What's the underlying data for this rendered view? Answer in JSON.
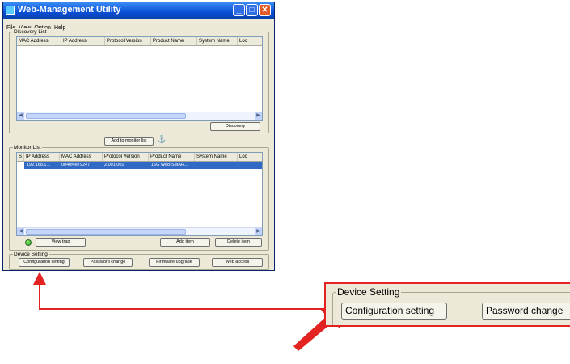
{
  "window": {
    "title": "Web-Management Utility"
  },
  "menu": [
    "File",
    "View",
    "Option",
    "Help"
  ],
  "discovery": {
    "legend": "Discovery List",
    "columns": [
      "MAC Address",
      "IP Address",
      "Protocol Version",
      "Product Name",
      "System Name",
      "Loc"
    ],
    "button": "Discovery"
  },
  "add_monitor_button": "Add to monitor list",
  "monitor": {
    "legend": "Monitor List",
    "columns": [
      "S",
      "IP Address",
      "MAC Address",
      "Protocol Version",
      "Product Name",
      "System Name",
      "Loc"
    ],
    "rows": [
      {
        "ip": "192.168.1.1",
        "mac": "0040f4e79247",
        "protocol": "2.001.001",
        "product": "16G Web-SMAR..."
      }
    ],
    "view_trap": "View trap",
    "add_item": "Add item",
    "delete_item": "Delete item"
  },
  "device_setting": {
    "legend": "Device Setting",
    "config": "Configuration setting",
    "password": "Password change",
    "firmware": "Firmware upgrade",
    "web": "Web access"
  },
  "zoom": {
    "legend": "Device Setting",
    "config": "Configuration setting",
    "password": "Password change"
  },
  "colors": {
    "callout": "#e32222",
    "selection": "#316ac5",
    "titlebar": "#0a4fd6"
  }
}
